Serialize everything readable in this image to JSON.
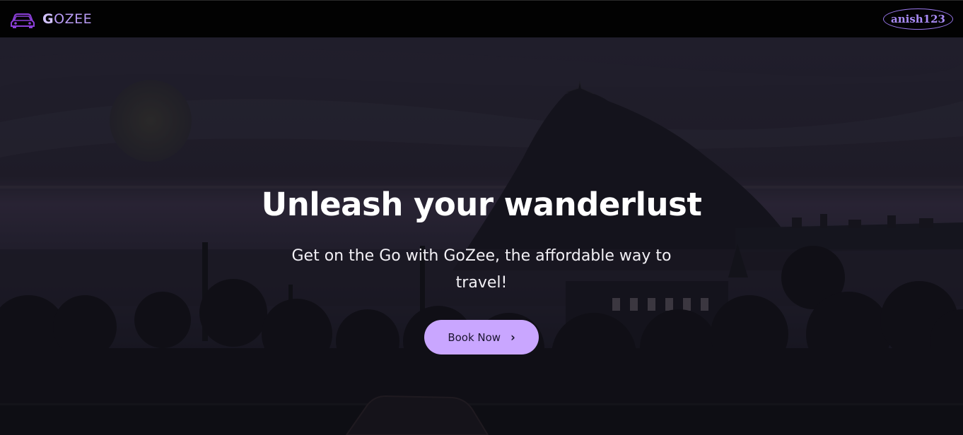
{
  "navbar": {
    "brand_g": "G",
    "brand_rest": "OZEE",
    "brand_icon": "car-icon",
    "user": "anish123",
    "accent": "#9a78ee"
  },
  "hero": {
    "title": "Unleash your wanderlust",
    "subtitle": "Get on the Go with GoZee, the affordable way to travel!",
    "cta_label": "Book Now",
    "cta_icon": "chevron-right-icon",
    "cta_color": "#c9a6ff"
  }
}
